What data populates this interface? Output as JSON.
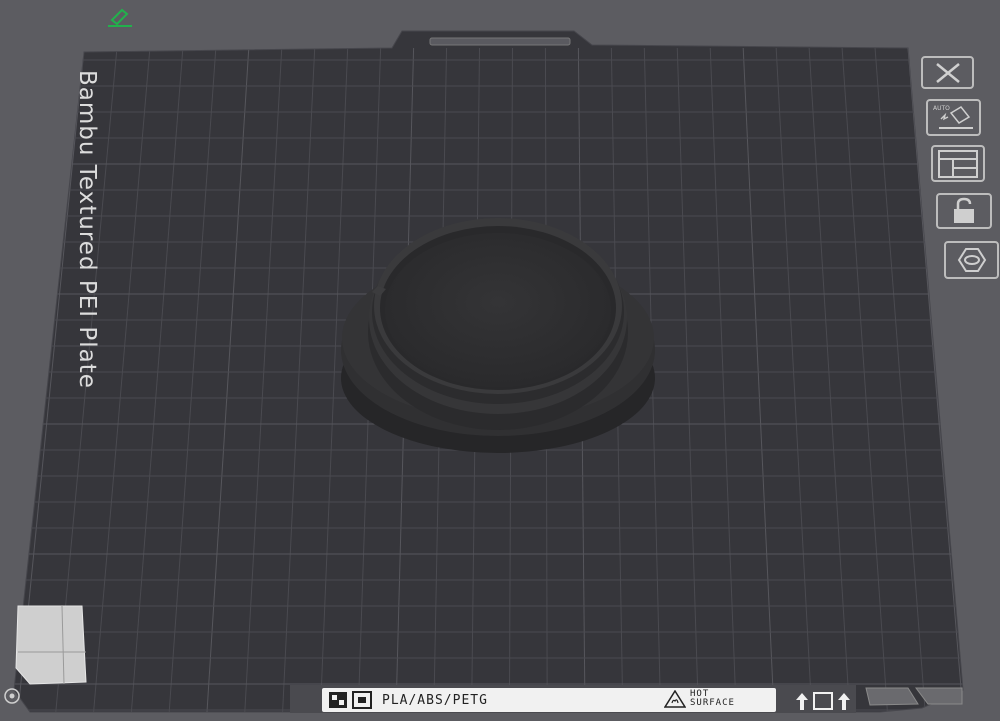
{
  "bed": {
    "plate_name": "Bambu Textured PEI Plate",
    "material_label": "PLA/ABS/PETG",
    "hot_line1": "HOT",
    "hot_line2": "SURFACE"
  },
  "toolbar": {
    "buttons": [
      {
        "name": "close-icon"
      },
      {
        "name": "auto-orient-icon",
        "label": "AUTO"
      },
      {
        "name": "arrange-icon"
      },
      {
        "name": "lock-icon"
      },
      {
        "name": "plate-settings-icon"
      }
    ]
  },
  "top": {
    "edit_icon": "edit-icon"
  },
  "colors": {
    "background": "#5c5c61",
    "plate": "#36363b",
    "grid": "#4a4a50",
    "model": "#2e2e30",
    "edit_accent": "#22b14c"
  }
}
